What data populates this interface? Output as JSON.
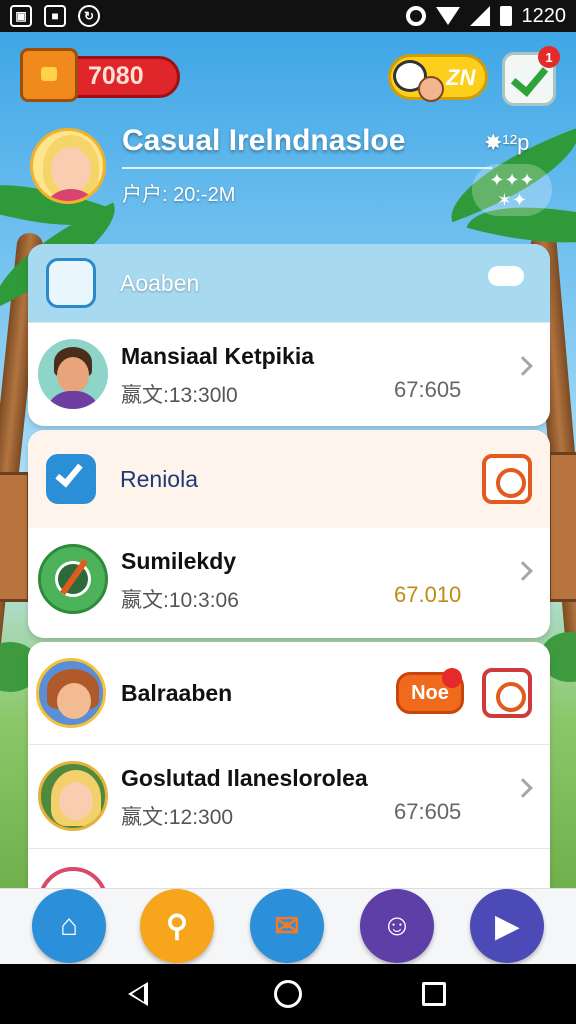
{
  "status_bar": {
    "time": "1220"
  },
  "header": {
    "coins": "7080",
    "chat_label": "ZN",
    "notification_count": "1",
    "profile_name": "Casual Irelndnasloe",
    "profile_sub": "户户: 20:-2M",
    "top_right_text": "✸¹²p",
    "sparkle_label": "✦✦✦\n✶✦"
  },
  "cards": [
    {
      "header_label": "Aoaben",
      "rows": [
        {
          "title": "Mansiaal  Ketpikia",
          "sub": "嬴文:13:30l0",
          "value": "67:605",
          "value_color": "#666666"
        }
      ]
    },
    {
      "header_label": "Reniola",
      "rows": [
        {
          "title": "Sumilekdy",
          "sub": "嬴文:10:3:06",
          "value": "67.010",
          "value_color": "#c28a14"
        }
      ]
    },
    {
      "header_label": "Balraaben",
      "badge_label": "Noe",
      "rows": [
        {
          "title": "Goslutad Ilanesloroleа",
          "sub": "嬴文:12:300",
          "value": "67:605",
          "value_color": "#666666"
        }
      ]
    }
  ],
  "colors": {
    "accent_red": "#e0262a",
    "accent_orange": "#e35a1e",
    "accent_green": "#2fa33b",
    "sky_blue": "#3fa6e6"
  },
  "bottom_nav": [
    {
      "icon": "home-icon",
      "color": "#2b8fd9"
    },
    {
      "icon": "search-icon",
      "color": "#f7a51b"
    },
    {
      "icon": "mail-icon",
      "color": "#2b8fd9"
    },
    {
      "icon": "profile-icon",
      "color": "#5e3fa8"
    },
    {
      "icon": "play-icon",
      "color": "#4c4ab6"
    }
  ]
}
